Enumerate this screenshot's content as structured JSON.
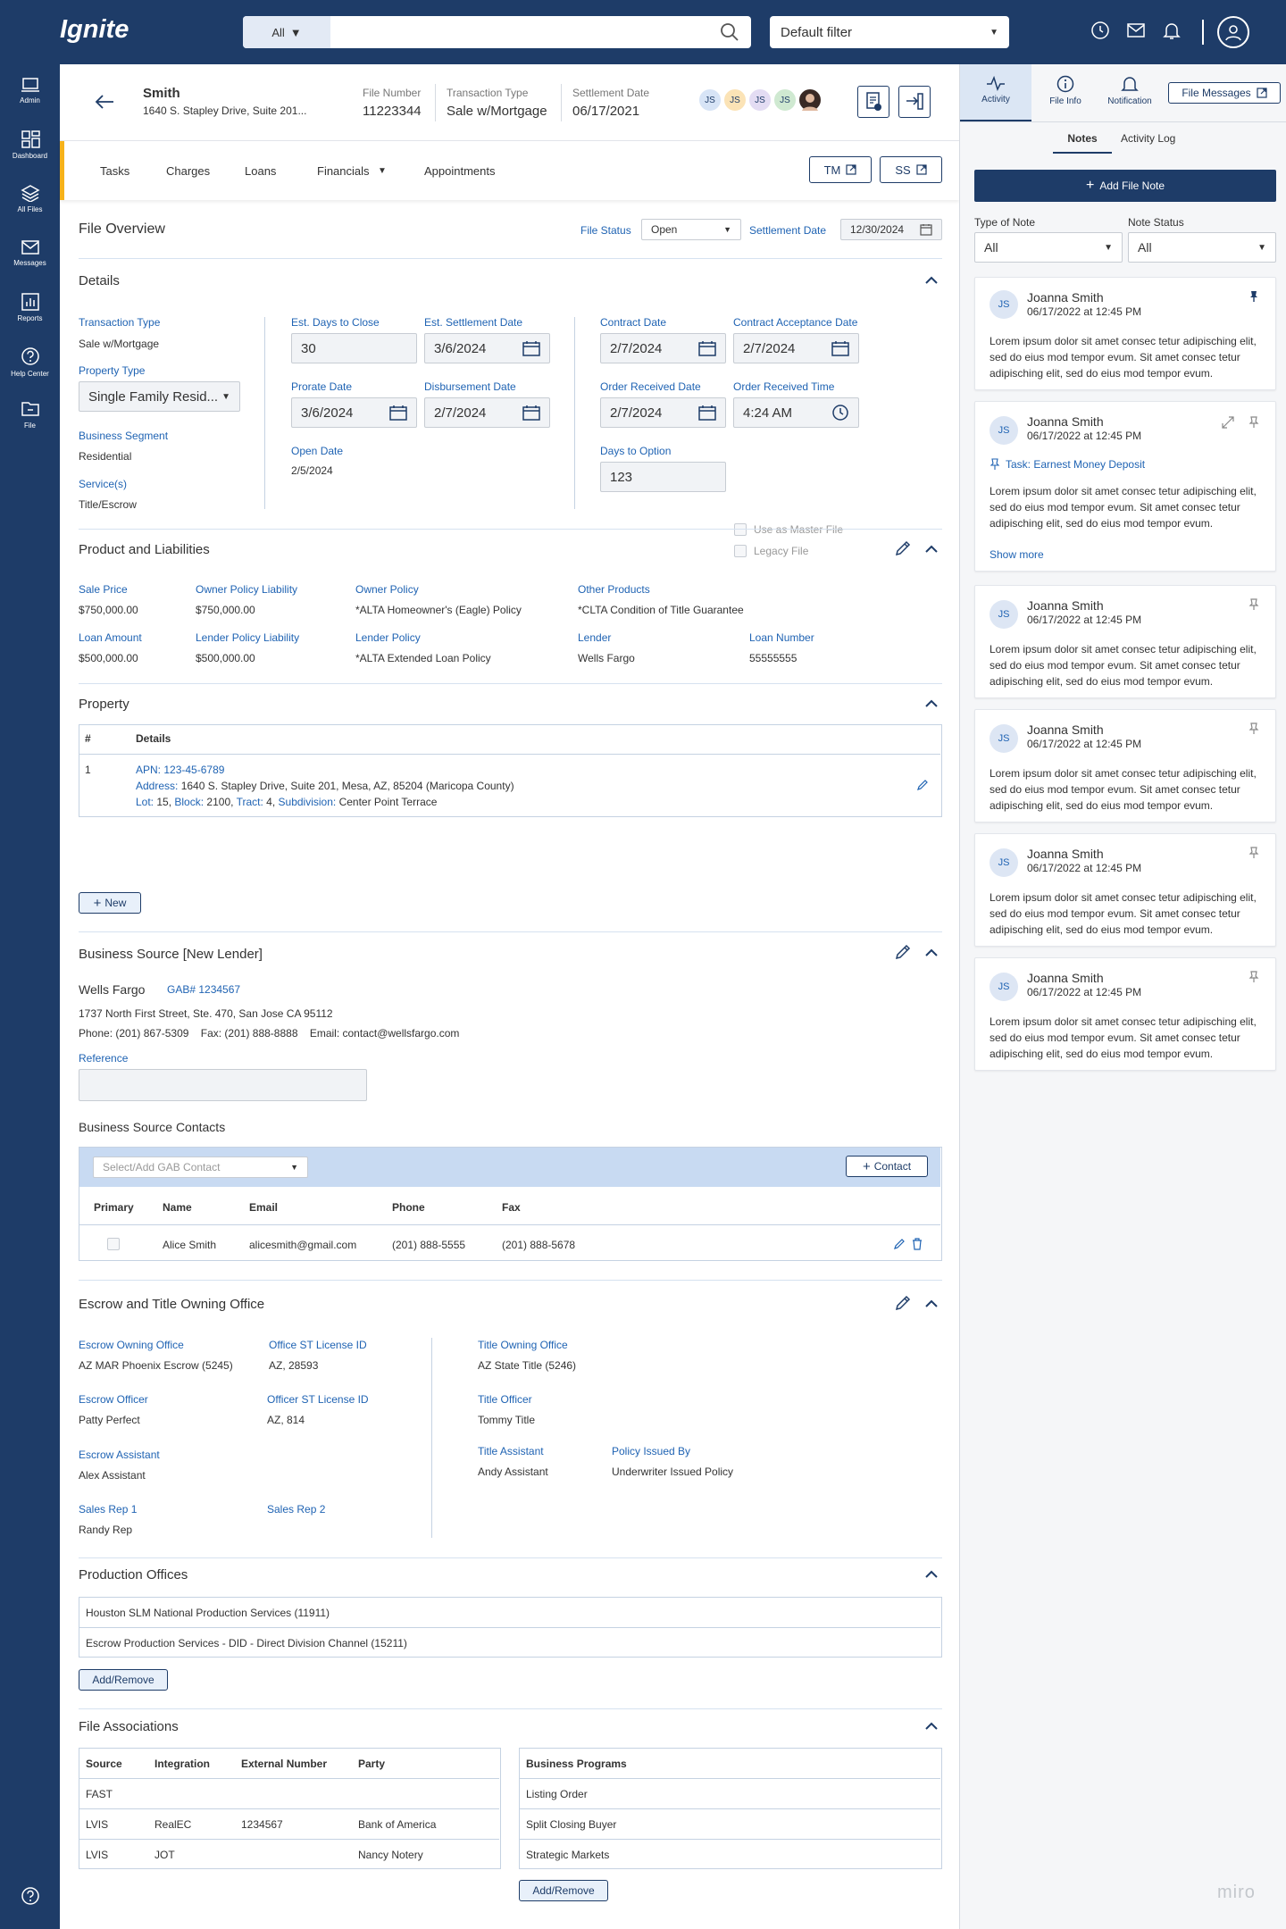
{
  "app": {
    "name": "Ignite"
  },
  "sidebar": {
    "items": [
      {
        "label": "Admin",
        "icon": "laptop-icon"
      },
      {
        "label": "Dashboard",
        "icon": "dashboard-icon"
      },
      {
        "label": "All Files",
        "icon": "layers-icon"
      },
      {
        "label": "Messages",
        "icon": "mail-icon"
      },
      {
        "label": "Reports",
        "icon": "chart-icon"
      },
      {
        "label": "Help Center",
        "icon": "help-icon"
      },
      {
        "label": "File",
        "icon": "folder-icon"
      }
    ]
  },
  "topbar": {
    "search_category": "All",
    "search_placeholder": "",
    "filter": "Default filter"
  },
  "file": {
    "name": "Smith",
    "address": "1640 S. Stapley Drive, Suite 201...",
    "file_number_label": "File Number",
    "file_number": "11223344",
    "transaction_type_label": "Transaction Type",
    "transaction_type": "Sale w/Mortgage",
    "settlement_date_label": "Settlement Date",
    "settlement_date": "06/17/2021",
    "avatars": [
      "JS",
      "JS",
      "JS",
      "JS"
    ]
  },
  "tabs": [
    {
      "label": "Tasks"
    },
    {
      "label": "Charges"
    },
    {
      "label": "Loans"
    },
    {
      "label": "Financials"
    },
    {
      "label": "Appointments"
    }
  ],
  "tab_buttons": {
    "tm": "TM",
    "ss": "SS"
  },
  "overview": {
    "title": "File Overview",
    "status_label": "File Status",
    "status": "Open",
    "settlement_label": "Settlement Date",
    "settlement": "12/30/2024"
  },
  "details": {
    "title": "Details",
    "transaction_type_label": "Transaction Type",
    "transaction_type": "Sale w/Mortgage",
    "property_type_label": "Property Type",
    "property_type": "Single Family Resid...",
    "business_segment_label": "Business Segment",
    "business_segment": "Residential",
    "services_label": "Service(s)",
    "services": "Title/Escrow",
    "est_days_label": "Est. Days to Close",
    "est_days": "30",
    "est_settlement_label": "Est. Settlement Date",
    "est_settlement": "3/6/2024",
    "prorate_label": "Prorate Date",
    "prorate": "3/6/2024",
    "disbursement_label": "Disbursement Date",
    "disbursement": "2/7/2024",
    "open_label": "Open Date",
    "open": "2/5/2024",
    "contract_label": "Contract Date",
    "contract": "2/7/2024",
    "contract_accept_label": "Contract Acceptance Date",
    "contract_accept": "2/7/2024",
    "order_received_label": "Order Received Date",
    "order_received": "2/7/2024",
    "order_time_label": "Order Received Time",
    "order_time": "4:24 AM",
    "days_option_label": "Days to Option",
    "days_option": "123",
    "master_file_label": "Use as Master File",
    "legacy_file_label": "Legacy File"
  },
  "product": {
    "title": "Product and Liabilities",
    "sale_price_label": "Sale Price",
    "sale_price": "$750,000.00",
    "owner_liab_label": "Owner Policy Liability",
    "owner_liab": "$750,000.00",
    "owner_policy_label": "Owner Policy",
    "owner_policy": "*ALTA Homeowner's (Eagle) Policy",
    "other_label": "Other Products",
    "other": "*CLTA Condition of Title Guarantee",
    "loan_amount_label": "Loan Amount",
    "loan_amount": "$500,000.00",
    "lender_liab_label": "Lender Policy Liability",
    "lender_liab": "$500,000.00",
    "lender_policy_label": "Lender Policy",
    "lender_policy": "*ALTA Extended Loan Policy",
    "lender_label": "Lender",
    "lender": "Wells Fargo",
    "loan_number_label": "Loan Number",
    "loan_number": "55555555"
  },
  "property": {
    "title": "Property",
    "col_num": "#",
    "col_details": "Details",
    "row_num": "1",
    "apn_label": "APN:",
    "apn": "123-45-6789",
    "address_label": "Address:",
    "address": "1640 S. Stapley Drive, Suite 201, Mesa, AZ, 85204 (Maricopa County)",
    "lot_label": "Lot:",
    "lot": "15,",
    "block_label": "Block:",
    "block": "2100,",
    "tract_label": "Tract:",
    "tract": "4,",
    "subdivision_label": "Subdivision:",
    "subdivision": "Center Point Terrace",
    "new_button": "New"
  },
  "business_source": {
    "title": "Business Source [New Lender]",
    "name": "Wells Fargo",
    "gab": "GAB# 1234567",
    "address": "1737 North First Street, Ste. 470, San Jose CA 95112",
    "contact_line": "Phone: (201) 867-5309    Fax: (201) 888-8888    Email: contact@wellsfargo.com",
    "reference_label": "Reference",
    "reference": "",
    "contacts_title": "Business Source Contacts",
    "contact_select": "Select/Add GAB Contact",
    "contact_button": "Contact",
    "headers": [
      "Primary",
      "Name",
      "Email",
      "Phone",
      "Fax"
    ],
    "rows": [
      {
        "name": "Alice Smith",
        "email": "alicesmith@gmail.com",
        "phone": "(201) 888-5555",
        "fax": "(201) 888-5678"
      }
    ]
  },
  "escrow": {
    "title": "Escrow and Title Owning Office",
    "escrow_office_label": "Escrow Owning Office",
    "escrow_office": "AZ MAR Phoenix Escrow (5245)",
    "office_license_label": "Office ST License ID",
    "office_license": "AZ, 28593",
    "escrow_officer_label": "Escrow Officer",
    "escrow_officer": "Patty Perfect",
    "officer_license_label": "Officer ST License ID",
    "officer_license": "AZ, 814",
    "escrow_assistant_label": "Escrow Assistant",
    "escrow_assistant": "Alex Assistant",
    "sales_rep1_label": "Sales Rep 1",
    "sales_rep1": "Randy Rep",
    "sales_rep2_label": "Sales Rep 2",
    "title_office_label": "Title Owning Office",
    "title_office": "AZ State Title (5246)",
    "title_officer_label": "Title Officer",
    "title_officer": "Tommy Title",
    "title_assistant_label": "Title Assistant",
    "title_assistant": "Andy Assistant",
    "policy_issued_label": "Policy Issued By",
    "policy_issued": "Underwriter Issued Policy"
  },
  "production": {
    "title": "Production Offices",
    "items": [
      "Houston SLM National Production Services (11911)",
      "Escrow Production Services - DID - Direct Division Channel (15211)"
    ],
    "button": "Add/Remove"
  },
  "associations": {
    "title": "File Associations",
    "headers": [
      "Source",
      "Integration",
      "External Number",
      "Party"
    ],
    "rows": [
      [
        "FAST",
        "",
        "",
        ""
      ],
      [
        "LVIS",
        "RealEC",
        "1234567",
        "Bank of America"
      ],
      [
        "LVIS",
        "JOT",
        "",
        "Nancy Notery"
      ]
    ],
    "programs_header": "Business Programs",
    "programs": [
      "Listing Order",
      "Split Closing Buyer",
      "Strategic Markets"
    ],
    "button": "Add/Remove"
  },
  "rpanel": {
    "tabs": [
      {
        "label": "Activity"
      },
      {
        "label": "File Info"
      },
      {
        "label": "Notification"
      }
    ],
    "file_messages": "File Messages",
    "subtabs": [
      "Notes",
      "Activity Log"
    ],
    "add_note": "Add File Note",
    "type_label": "Type of Note",
    "type": "All",
    "status_label": "Note Status",
    "status": "All",
    "task_label": "Task: Earnest Money Deposit",
    "show_more": "Show more",
    "notes": [
      {
        "initials": "JS",
        "name": "Joanna Smith",
        "date": "06/17/2022 at 12:45 PM",
        "text": "Lorem ipsum dolor sit amet consec tetur adipisching elit, sed do eius mod tempor evum. Sit amet consec tetur adipisching elit, sed do eius mod tempor evum."
      },
      {
        "initials": "JS",
        "name": "Joanna Smith",
        "date": "06/17/2022 at 12:45 PM",
        "text": "Lorem ipsum dolor sit amet consec tetur adipisching elit, sed do eius mod tempor evum. Sit amet consec tetur adipisching elit, sed do eius mod tempor evum."
      },
      {
        "initials": "JS",
        "name": "Joanna Smith",
        "date": "06/17/2022 at 12:45 PM",
        "text": "Lorem ipsum dolor sit amet consec tetur adipisching elit, sed do eius mod tempor evum. Sit amet consec tetur adipisching elit, sed do eius mod tempor evum."
      },
      {
        "initials": "JS",
        "name": "Joanna Smith",
        "date": "06/17/2022 at 12:45 PM",
        "text": "Lorem ipsum dolor sit amet consec tetur adipisching elit, sed do eius mod tempor evum. Sit amet consec tetur adipisching elit, sed do eius mod tempor evum."
      },
      {
        "initials": "JS",
        "name": "Joanna Smith",
        "date": "06/17/2022 at 12:45 PM",
        "text": "Lorem ipsum dolor sit amet consec tetur adipisching elit, sed do eius mod tempor evum. Sit amet consec tetur adipisching elit, sed do eius mod tempor evum."
      },
      {
        "initials": "JS",
        "name": "Joanna Smith",
        "date": "06/17/2022 at 12:45 PM",
        "text": "Lorem ipsum dolor sit amet consec tetur adipisching elit, sed do eius mod tempor evum. Sit amet consec tetur adipisching elit, sed do eius mod tempor evum."
      }
    ]
  },
  "watermark": "miro",
  "colors": {
    "navy": "#1e3c68",
    "link": "#1f63b3",
    "accent": "#f6b21a",
    "light": "#c8daf2"
  }
}
